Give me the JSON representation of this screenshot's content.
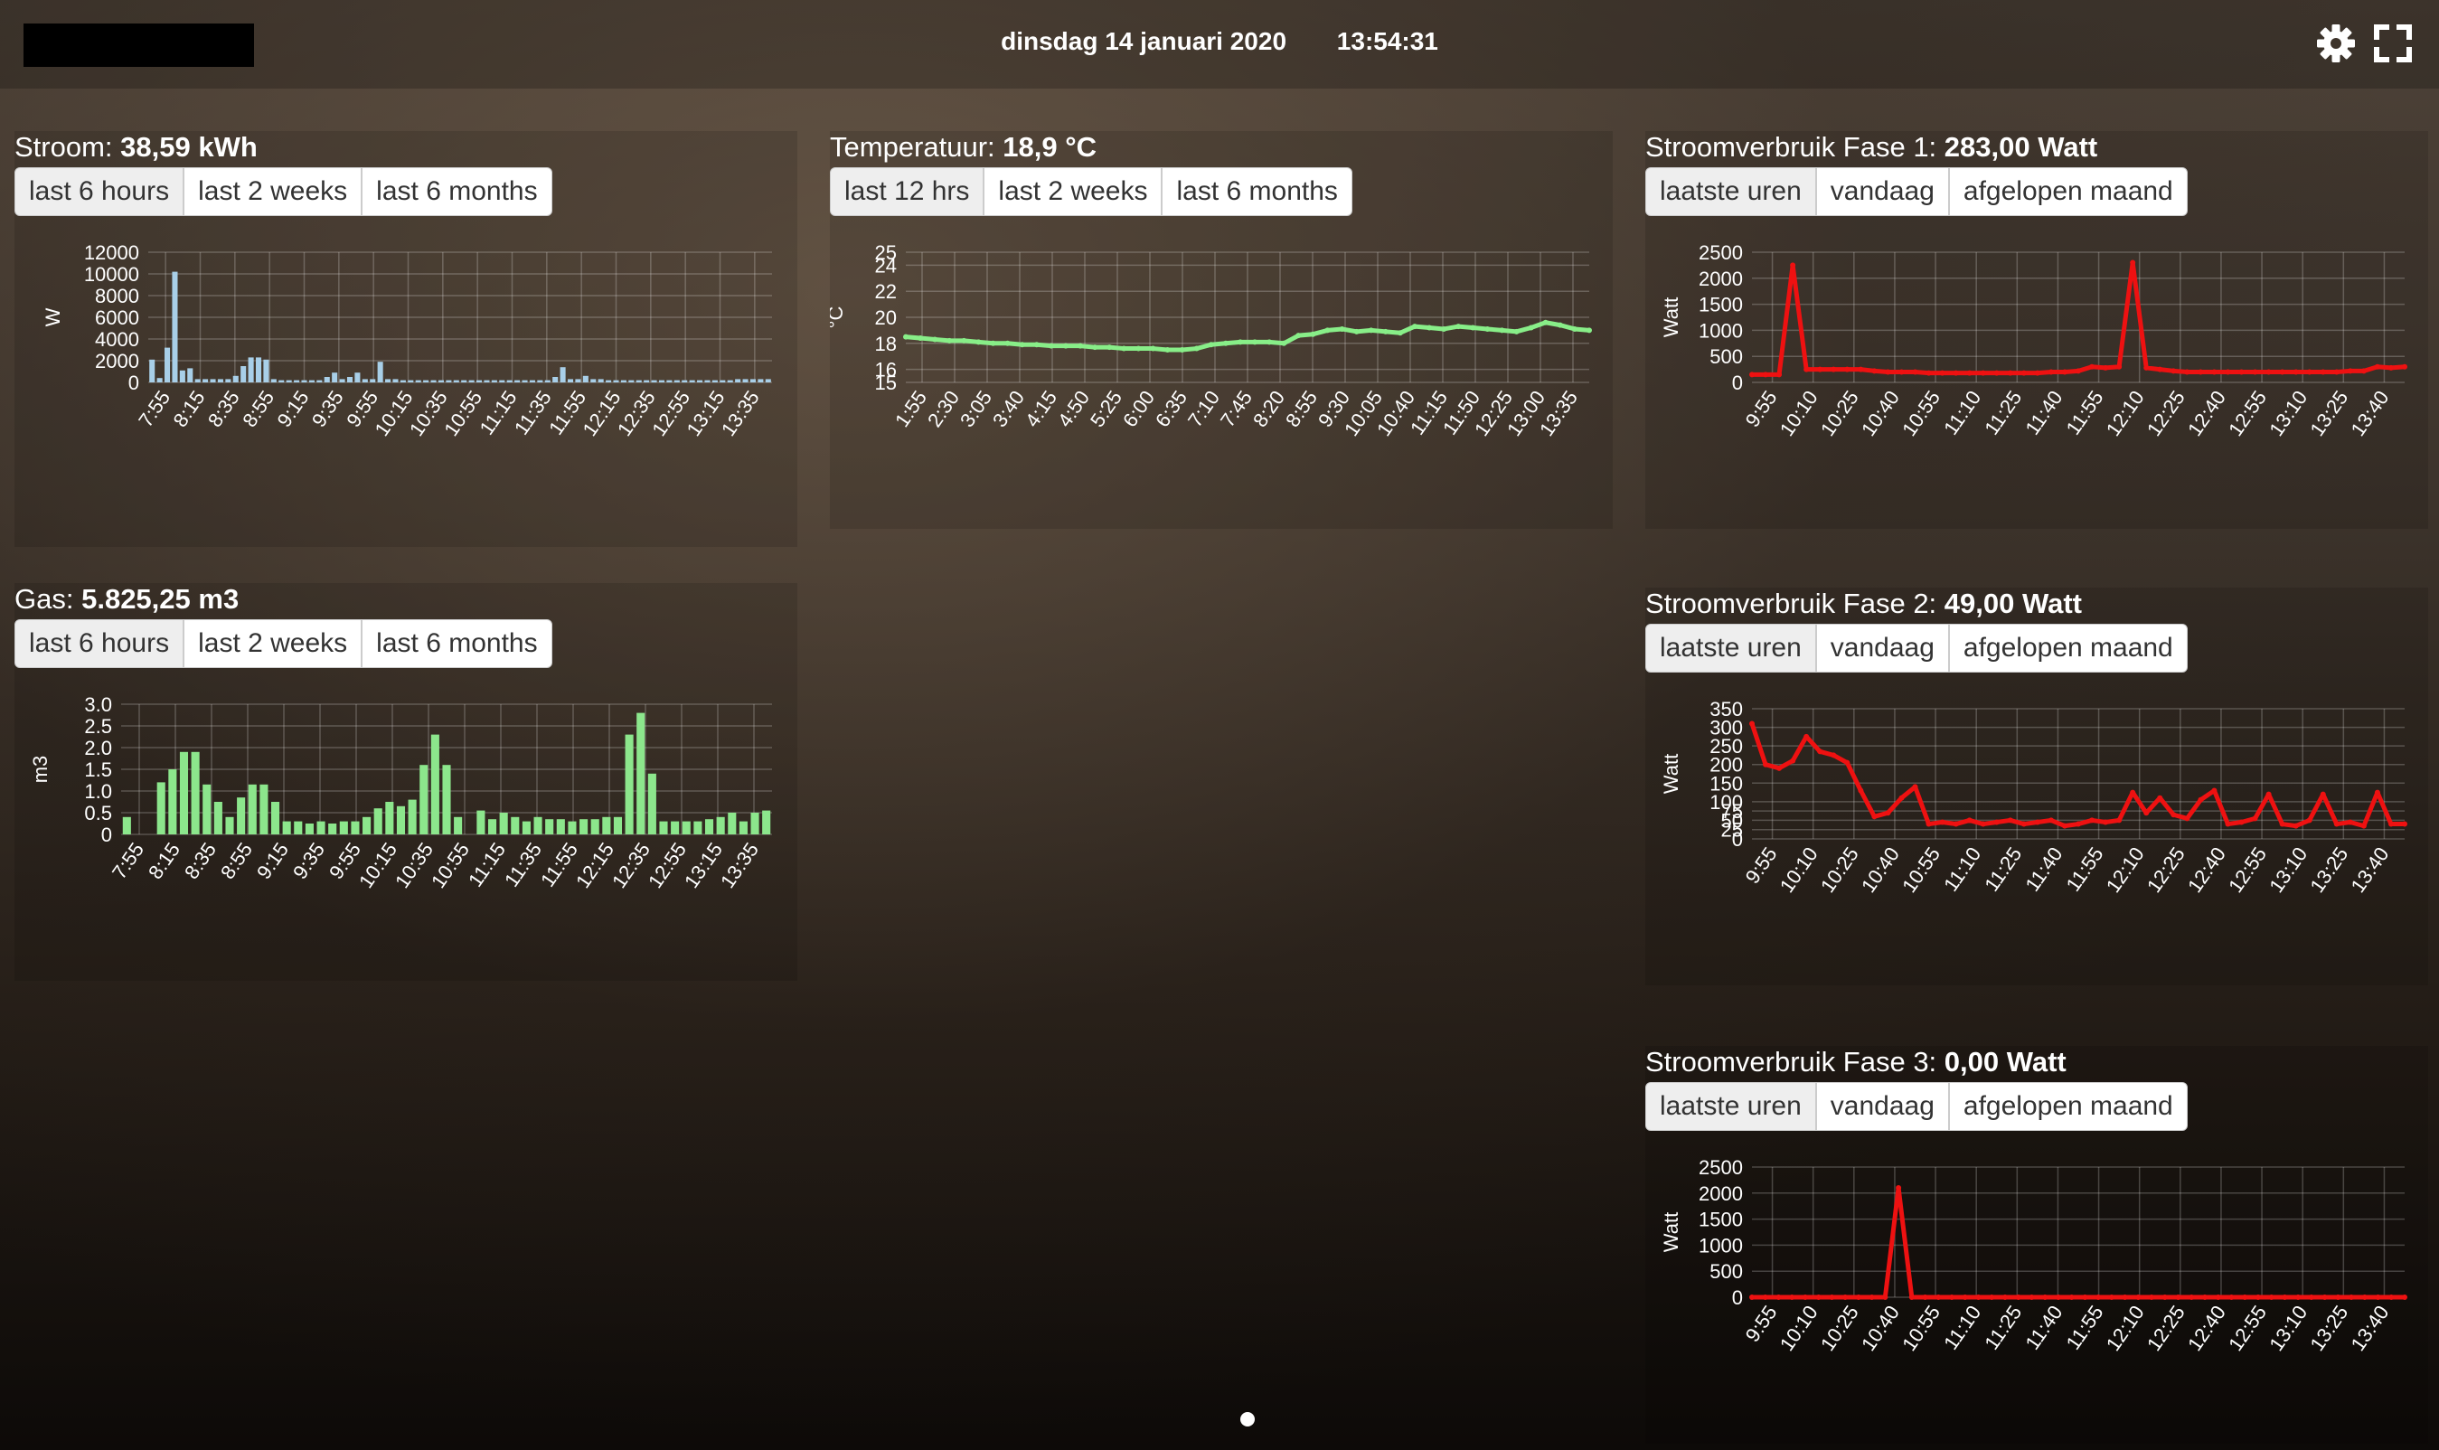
{
  "header": {
    "date": "dinsdag 14 januari 2020",
    "time": "13:54:31",
    "settings_icon": "gear-icon",
    "fullscreen_icon": "fullscreen-icon"
  },
  "panels": [
    {
      "id": "stroom",
      "title_label": "Stroom:",
      "title_value": "38,59 kWh",
      "buttons": [
        "last 6 hours",
        "last 2 weeks",
        "last 6 months"
      ],
      "chart_index": 0
    },
    {
      "id": "temp",
      "title_label": "Temperatuur:",
      "title_value": "18,9 °C",
      "buttons": [
        "last 12 hrs",
        "last 2 weeks",
        "last 6 months"
      ],
      "chart_index": 1
    },
    {
      "id": "fase1",
      "title_label": "Stroomverbruik Fase 1:",
      "title_value": "283,00 Watt",
      "buttons": [
        "laatste uren",
        "vandaag",
        "afgelopen maand"
      ],
      "chart_index": 2
    },
    {
      "id": "gas",
      "title_label": "Gas:",
      "title_value": "5.825,25 m3",
      "buttons": [
        "last 6 hours",
        "last 2 weeks",
        "last 6 months"
      ],
      "chart_index": 3
    },
    {
      "id": "fase2",
      "title_label": "Stroomverbruik Fase 2:",
      "title_value": "49,00 Watt",
      "buttons": [
        "laatste uren",
        "vandaag",
        "afgelopen maand"
      ],
      "chart_index": 4
    },
    {
      "id": "fase3",
      "title_label": "Stroomverbruik Fase 3:",
      "title_value": "0,00 Watt",
      "buttons": [
        "laatste uren",
        "vandaag",
        "afgelopen maand"
      ],
      "chart_index": 5
    }
  ],
  "chart_data": [
    {
      "type": "bar",
      "ylabel": "W",
      "color": "#a8cfe8",
      "ylim": [
        0,
        12000
      ],
      "yticks": [
        "0",
        "2000",
        "4000",
        "6000",
        "8000",
        "10000",
        "12000"
      ],
      "xticks": [
        "7:55",
        "8:15",
        "8:35",
        "8:55",
        "9:15",
        "9:35",
        "9:55",
        "10:15",
        "10:35",
        "10:55",
        "11:15",
        "11:35",
        "11:55",
        "12:15",
        "12:35",
        "12:55",
        "13:15",
        "13:35"
      ],
      "values": [
        2100,
        400,
        3200,
        10200,
        1100,
        1300,
        300,
        300,
        300,
        300,
        300,
        600,
        1500,
        2300,
        2300,
        2100,
        300,
        200,
        200,
        200,
        200,
        200,
        200,
        500,
        900,
        300,
        500,
        900,
        300,
        300,
        1900,
        300,
        300,
        200,
        200,
        200,
        200,
        200,
        200,
        200,
        200,
        200,
        200,
        200,
        200,
        200,
        200,
        200,
        200,
        200,
        200,
        200,
        200,
        500,
        1400,
        300,
        300,
        600,
        300,
        300,
        200,
        200,
        200,
        200,
        200,
        200,
        200,
        200,
        200,
        200,
        200,
        200,
        200,
        200,
        200,
        200,
        200,
        300,
        300,
        300,
        300,
        300
      ]
    },
    {
      "type": "line",
      "ylabel": "°C",
      "color": "#88ee88",
      "ylim": [
        15,
        25
      ],
      "yticks": [
        "15",
        "16",
        "18",
        "20",
        "22",
        "24",
        "25"
      ],
      "xticks": [
        "1:55",
        "2:30",
        "3:05",
        "3:40",
        "4:15",
        "4:50",
        "5:25",
        "6:00",
        "6:35",
        "7:10",
        "7:45",
        "8:20",
        "8:55",
        "9:30",
        "10:05",
        "10:40",
        "11:15",
        "11:50",
        "12:25",
        "13:00",
        "13:35"
      ],
      "values": [
        18.5,
        18.4,
        18.3,
        18.2,
        18.2,
        18.1,
        18.0,
        18.0,
        17.9,
        17.9,
        17.8,
        17.8,
        17.8,
        17.7,
        17.7,
        17.6,
        17.6,
        17.6,
        17.5,
        17.5,
        17.6,
        17.9,
        18.0,
        18.1,
        18.1,
        18.1,
        18.0,
        18.6,
        18.7,
        19.0,
        19.1,
        18.9,
        19.0,
        18.9,
        18.8,
        19.3,
        19.2,
        19.1,
        19.3,
        19.2,
        19.1,
        19.0,
        18.9,
        19.2,
        19.6,
        19.4,
        19.1,
        19.0
      ]
    },
    {
      "type": "line",
      "ylabel": "Watt",
      "color": "#ee1111",
      "ylim": [
        0,
        2500
      ],
      "yticks": [
        "0",
        "500",
        "1000",
        "1500",
        "2000",
        "2500"
      ],
      "xticks": [
        "9:55",
        "10:10",
        "10:25",
        "10:40",
        "10:55",
        "11:10",
        "11:25",
        "11:40",
        "11:55",
        "12:10",
        "12:25",
        "12:40",
        "12:55",
        "13:10",
        "13:25",
        "13:40"
      ],
      "values": [
        150,
        150,
        150,
        2250,
        250,
        250,
        250,
        250,
        250,
        220,
        200,
        200,
        200,
        180,
        180,
        180,
        180,
        180,
        180,
        180,
        180,
        180,
        200,
        200,
        220,
        300,
        280,
        300,
        2300,
        280,
        250,
        220,
        200,
        200,
        200,
        200,
        200,
        200,
        200,
        200,
        200,
        200,
        200,
        200,
        220,
        220,
        300,
        280,
        300
      ]
    },
    {
      "type": "bar",
      "ylabel": "m3",
      "color": "#8ce68c",
      "ylim": [
        0,
        3.0
      ],
      "yticks": [
        "0",
        "0.5",
        "1.0",
        "1.5",
        "2.0",
        "2.5",
        "3.0"
      ],
      "xticks": [
        "7:55",
        "8:15",
        "8:35",
        "8:55",
        "9:15",
        "9:35",
        "9:55",
        "10:15",
        "10:35",
        "10:55",
        "11:15",
        "11:35",
        "11:55",
        "12:15",
        "12:35",
        "12:55",
        "13:15",
        "13:35"
      ],
      "values": [
        0.4,
        0,
        0,
        1.2,
        1.5,
        1.9,
        1.9,
        1.15,
        0.75,
        0.4,
        0.85,
        1.15,
        1.15,
        0.75,
        0.3,
        0.3,
        0.25,
        0.3,
        0.25,
        0.3,
        0.3,
        0.4,
        0.6,
        0.75,
        0.65,
        0.8,
        1.6,
        2.3,
        1.6,
        0.4,
        0,
        0.55,
        0.35,
        0.5,
        0.4,
        0.3,
        0.4,
        0.35,
        0.35,
        0.3,
        0.35,
        0.35,
        0.4,
        0.4,
        2.3,
        2.8,
        1.4,
        0.3,
        0.3,
        0.3,
        0.3,
        0.35,
        0.4,
        0.5,
        0.3,
        0.5,
        0.55
      ]
    },
    {
      "type": "line",
      "ylabel": "Watt",
      "color": "#ee1111",
      "ylim": [
        0,
        350
      ],
      "yticks": [
        "0",
        "25",
        "50",
        "75",
        "100",
        "150",
        "200",
        "250",
        "300",
        "350"
      ],
      "xticks": [
        "9:55",
        "10:10",
        "10:25",
        "10:40",
        "10:55",
        "11:10",
        "11:25",
        "11:40",
        "11:55",
        "12:10",
        "12:25",
        "12:40",
        "12:55",
        "13:10",
        "13:25",
        "13:40"
      ],
      "values": [
        310,
        200,
        190,
        210,
        275,
        235,
        225,
        205,
        130,
        60,
        70,
        110,
        140,
        40,
        45,
        40,
        50,
        40,
        45,
        50,
        40,
        45,
        50,
        35,
        40,
        50,
        45,
        50,
        125,
        70,
        110,
        65,
        55,
        105,
        130,
        40,
        45,
        55,
        120,
        40,
        35,
        50,
        120,
        40,
        45,
        35,
        125,
        40,
        40
      ]
    },
    {
      "type": "line",
      "ylabel": "Watt",
      "color": "#ee1111",
      "ylim": [
        0,
        2500
      ],
      "yticks": [
        "0",
        "500",
        "1000",
        "1500",
        "2000",
        "2500"
      ],
      "xticks": [
        "9:55",
        "10:10",
        "10:25",
        "10:40",
        "10:55",
        "11:10",
        "11:25",
        "11:40",
        "11:55",
        "12:10",
        "12:25",
        "12:40",
        "12:55",
        "13:10",
        "13:25",
        "13:40"
      ],
      "values": [
        0,
        0,
        0,
        0,
        0,
        0,
        0,
        0,
        0,
        0,
        0,
        2100,
        0,
        0,
        0,
        0,
        0,
        0,
        0,
        0,
        0,
        0,
        0,
        0,
        0,
        0,
        0,
        0,
        0,
        0,
        0,
        0,
        0,
        0,
        0,
        0,
        0,
        0,
        0,
        0,
        0,
        0,
        0,
        0,
        0,
        0,
        0,
        0,
        0,
        0
      ]
    }
  ]
}
